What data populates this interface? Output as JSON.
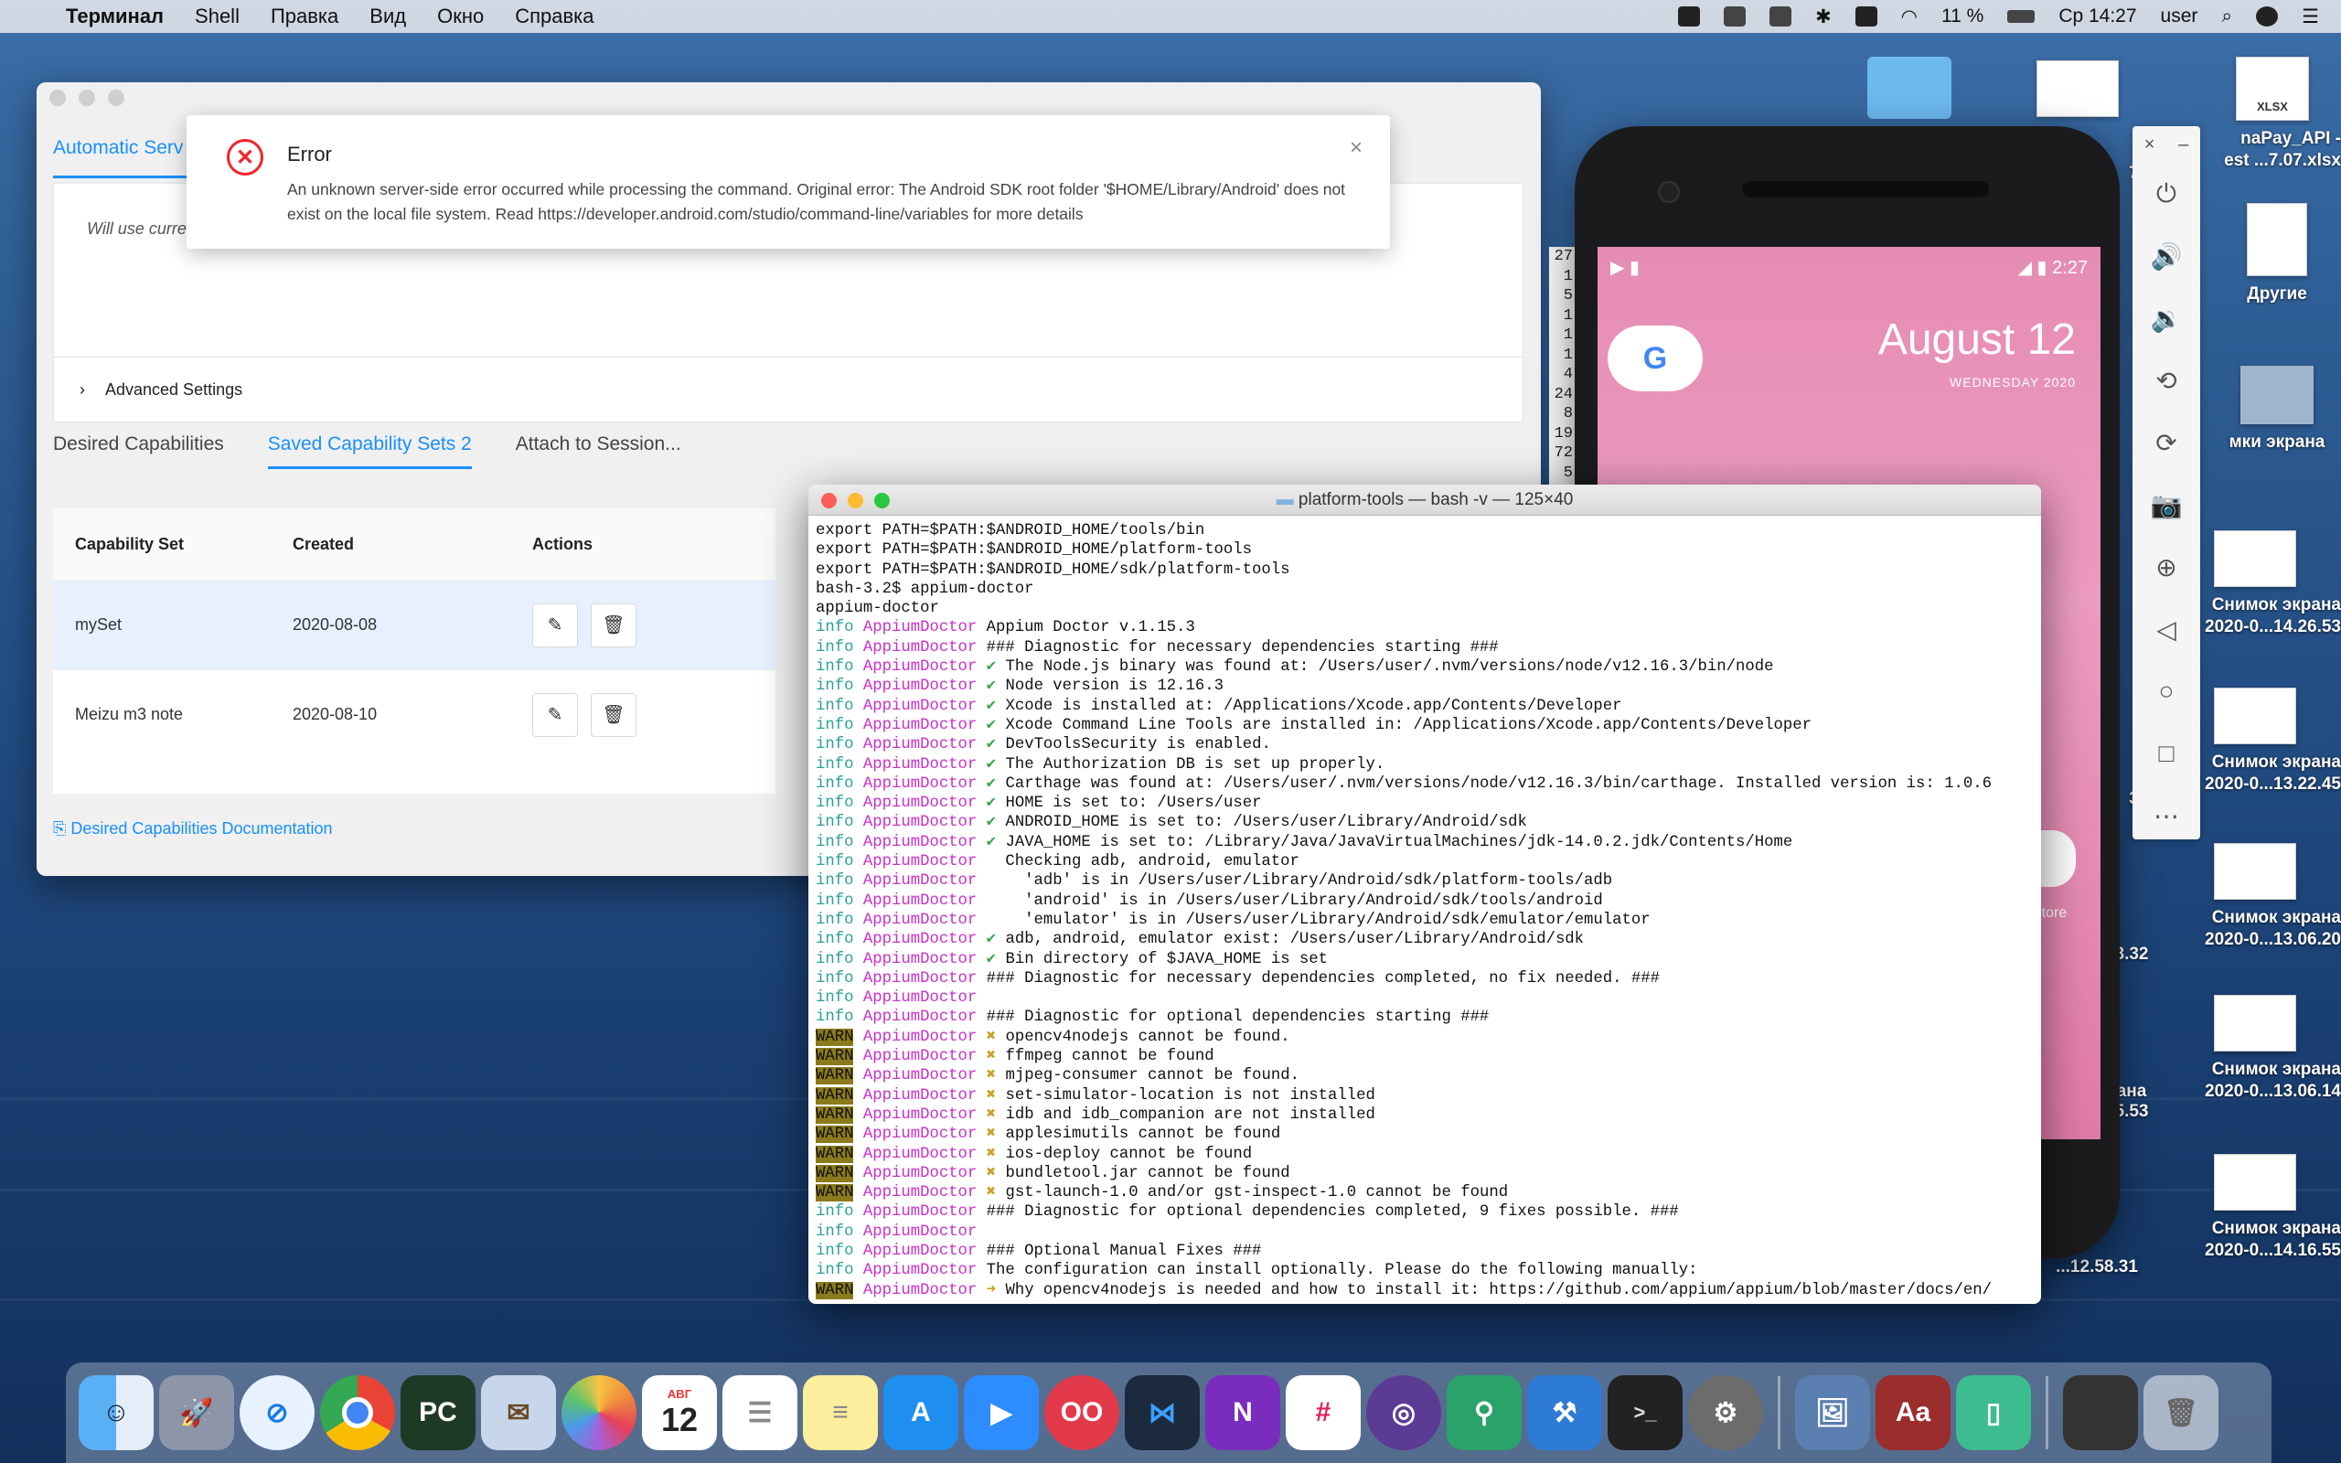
{
  "menubar": {
    "app": "Терминал",
    "items": [
      "Shell",
      "Правка",
      "Вид",
      "Окно",
      "Справка"
    ],
    "battery": "11 %",
    "clock": "Ср 14:27",
    "user": "user"
  },
  "appium": {
    "server_tab": "Automatic Serv",
    "server_text": "Will use curre",
    "advanced": "Advanced Settings",
    "tabs": [
      "Desired Capabilities",
      "Saved Capability Sets 2",
      "Attach to Session..."
    ],
    "table": {
      "headers": [
        "Capability Set",
        "Created",
        "Actions"
      ],
      "rows": [
        {
          "name": "mySet",
          "created": "2020-08-08"
        },
        {
          "name": "Meizu m3 note",
          "created": "2020-08-10"
        }
      ]
    },
    "doc_link": "Desired Capabilities Documentation"
  },
  "error": {
    "title": "Error",
    "message": "An unknown server-side error occurred while processing the command. Original error: The Android SDK root folder '$HOME/Library/Android' does not exist on the local file system. Read https://developer.android.com/studio/command-line/variables for more details"
  },
  "numcol": [
    "27",
    "1",
    "5",
    "1",
    "1",
    "1",
    "4",
    "24",
    "8",
    "19",
    "72",
    "5"
  ],
  "phone": {
    "time": "2:27",
    "date": "August 12",
    "day": "WEDNESDAY 2020",
    "store_label": "Store"
  },
  "desktop_icons": [
    {
      "label": "XLSX"
    },
    {
      "label": "naPay_API -\nest ...7.07.xlsx"
    },
    {
      "label": "Другие"
    },
    {
      "label": "мки экрана"
    },
    {
      "label": "Снимок экрана\n2020-0...14.26.53"
    },
    {
      "label": "Снимок экрана\n2020-0...13.22.45"
    },
    {
      "label": "Снимок экрана\n2020-0...13.06.20"
    },
    {
      "label": "Снимок экрана\n2020-0...13.06.14"
    },
    {
      "label": "Снимок экрана\n2020-0...14.16.55"
    }
  ],
  "desktop_clipped": [
    "7.",
    "3.",
    "8.32",
    "5.53",
    "...12.58.31",
    "ана"
  ],
  "terminal": {
    "title": "platform-tools — bash -v — 125×40",
    "lines": [
      {
        "t": "plain",
        "text": "export PATH=$PATH:$ANDROID_HOME/tools/bin"
      },
      {
        "t": "plain",
        "text": "export PATH=$PATH:$ANDROID_HOME/platform-tools"
      },
      {
        "t": "plain",
        "text": "export PATH=$PATH:$ANDROID_HOME/sdk/platform-tools"
      },
      {
        "t": "plain",
        "text": "bash-3.2$ appium-doctor"
      },
      {
        "t": "plain",
        "text": "appium-doctor"
      },
      {
        "t": "info",
        "mark": "",
        "text": "Appium Doctor v.1.15.3"
      },
      {
        "t": "info",
        "mark": "",
        "text": "### Diagnostic for necessary dependencies starting ###"
      },
      {
        "t": "info",
        "mark": "✔",
        "text": "The Node.js binary was found at: /Users/user/.nvm/versions/node/v12.16.3/bin/node"
      },
      {
        "t": "info",
        "mark": "✔",
        "text": "Node version is 12.16.3"
      },
      {
        "t": "info",
        "mark": "✔",
        "text": "Xcode is installed at: /Applications/Xcode.app/Contents/Developer"
      },
      {
        "t": "info",
        "mark": "✔",
        "text": "Xcode Command Line Tools are installed in: /Applications/Xcode.app/Contents/Developer"
      },
      {
        "t": "info",
        "mark": "✔",
        "text": "DevToolsSecurity is enabled."
      },
      {
        "t": "info",
        "mark": "✔",
        "text": "The Authorization DB is set up properly."
      },
      {
        "t": "info",
        "mark": "✔",
        "text": "Carthage was found at: /Users/user/.nvm/versions/node/v12.16.3/bin/carthage. Installed version is: 1.0.6"
      },
      {
        "t": "info",
        "mark": "✔",
        "text": "HOME is set to: /Users/user"
      },
      {
        "t": "info",
        "mark": "✔",
        "text": "ANDROID_HOME is set to: /Users/user/Library/Android/sdk"
      },
      {
        "t": "info",
        "mark": "✔",
        "text": "JAVA_HOME is set to: /Library/Java/JavaVirtualMachines/jdk-14.0.2.jdk/Contents/Home"
      },
      {
        "t": "info",
        "mark": " ",
        "text": "Checking adb, android, emulator"
      },
      {
        "t": "info",
        "mark": " ",
        "text": "  'adb' is in /Users/user/Library/Android/sdk/platform-tools/adb"
      },
      {
        "t": "info",
        "mark": " ",
        "text": "  'android' is in /Users/user/Library/Android/sdk/tools/android"
      },
      {
        "t": "info",
        "mark": " ",
        "text": "  'emulator' is in /Users/user/Library/Android/sdk/emulator/emulator"
      },
      {
        "t": "info",
        "mark": "✔",
        "text": "adb, android, emulator exist: /Users/user/Library/Android/sdk"
      },
      {
        "t": "info",
        "mark": "✔",
        "text": "Bin directory of $JAVA_HOME is set"
      },
      {
        "t": "info",
        "mark": "",
        "text": "### Diagnostic for necessary dependencies completed, no fix needed. ###"
      },
      {
        "t": "info",
        "mark": "",
        "text": ""
      },
      {
        "t": "info",
        "mark": "",
        "text": "### Diagnostic for optional dependencies starting ###"
      },
      {
        "t": "warn",
        "mark": "✖",
        "text": "opencv4nodejs cannot be found."
      },
      {
        "t": "warn",
        "mark": "✖",
        "text": "ffmpeg cannot be found"
      },
      {
        "t": "warn",
        "mark": "✖",
        "text": "mjpeg-consumer cannot be found."
      },
      {
        "t": "warn",
        "mark": "✖",
        "text": "set-simulator-location is not installed"
      },
      {
        "t": "warn",
        "mark": "✖",
        "text": "idb and idb_companion are not installed"
      },
      {
        "t": "warn",
        "mark": "✖",
        "text": "applesimutils cannot be found"
      },
      {
        "t": "warn",
        "mark": "✖",
        "text": "ios-deploy cannot be found"
      },
      {
        "t": "warn",
        "mark": "✖",
        "text": "bundletool.jar cannot be found"
      },
      {
        "t": "warn",
        "mark": "✖",
        "text": "gst-launch-1.0 and/or gst-inspect-1.0 cannot be found"
      },
      {
        "t": "info",
        "mark": "",
        "text": "### Diagnostic for optional dependencies completed, 9 fixes possible. ###"
      },
      {
        "t": "info",
        "mark": "",
        "text": ""
      },
      {
        "t": "info",
        "mark": "",
        "text": "### Optional Manual Fixes ###"
      },
      {
        "t": "info",
        "mark": "",
        "text": "The configuration can install optionally. Please do the following manually:"
      },
      {
        "t": "warn",
        "mark": "➜",
        "text": "Why opencv4nodejs is needed and how to install it: https://github.com/appium/appium/blob/master/docs/en/"
      }
    ],
    "level_info": "info",
    "level_warn": "WARN",
    "tag": "AppiumDoctor"
  },
  "dock": {
    "calendar_month": "АВГ",
    "calendar_day": "12"
  },
  "colors": {
    "accent": "#1890ff",
    "error": "#f5222d"
  }
}
